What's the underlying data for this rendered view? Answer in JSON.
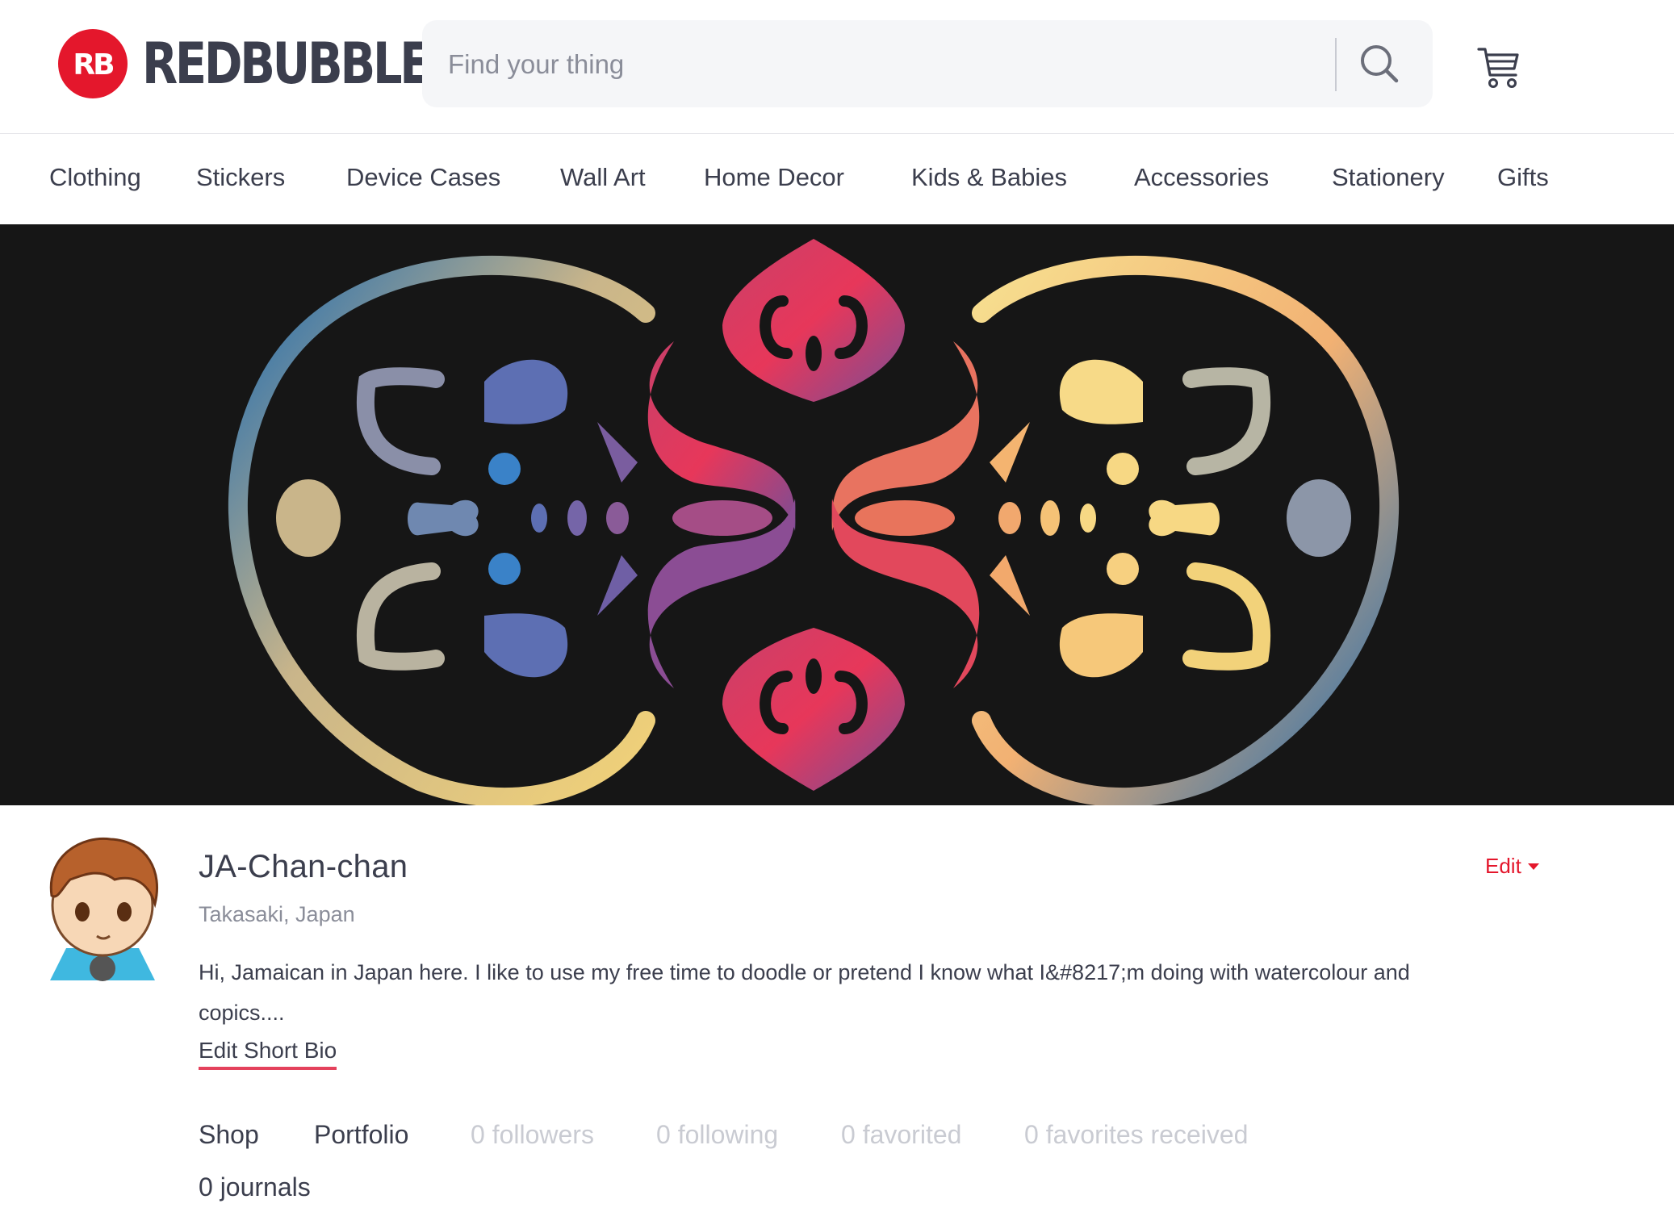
{
  "header": {
    "brand": "REDBUBBLE",
    "search_placeholder": "Find your thing",
    "icons": {
      "search": "search-icon",
      "cart": "cart-icon",
      "logo": "redbubble-logo"
    },
    "brand_color": "#e4172c"
  },
  "nav": {
    "items": [
      {
        "label": "Clothing"
      },
      {
        "label": "Stickers"
      },
      {
        "label": "Device Cases"
      },
      {
        "label": "Wall Art"
      },
      {
        "label": "Home Decor"
      },
      {
        "label": "Kids & Babies"
      },
      {
        "label": "Accessories"
      },
      {
        "label": "Stationery"
      },
      {
        "label": "Gifts"
      }
    ]
  },
  "profile": {
    "username": "JA-Chan-chan",
    "location": "Takasaki, Japan",
    "bio": "Hi, Jamaican in Japan here. I like to use my free time to doodle or pretend I know what I&#8217;m doing with watercolour and copics....",
    "edit_bio_label": "Edit Short Bio",
    "edit_label": "Edit",
    "accent_color": "#e4425c"
  },
  "tabs": {
    "shop": "Shop",
    "portfolio": "Portfolio",
    "followers": "0 followers",
    "following": "0 following",
    "favorited": "0 favorited",
    "favorites_received": "0 favorites received",
    "journals": "0 journals"
  }
}
